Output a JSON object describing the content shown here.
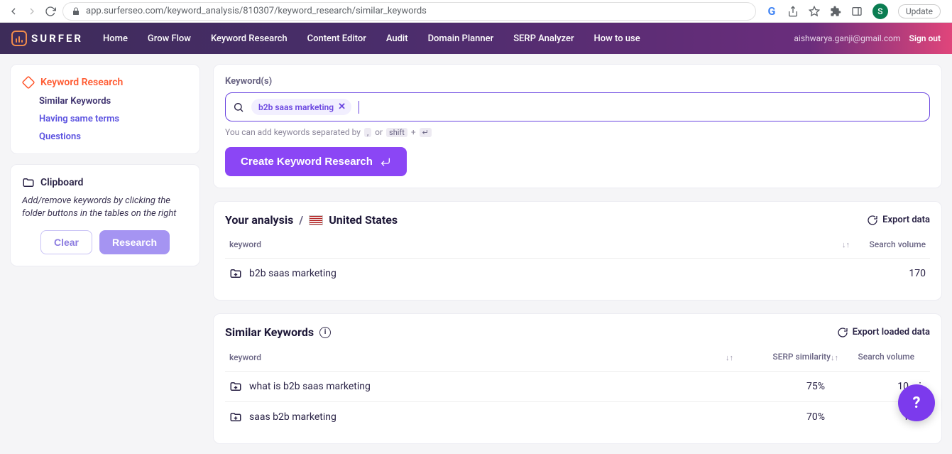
{
  "browser": {
    "url": "app.surferseo.com/keyword_analysis/810307/keyword_research/similar_keywords",
    "avatar_letter": "S",
    "update_label": "Update"
  },
  "nav": {
    "brand": "SURFER",
    "links": [
      "Home",
      "Grow Flow",
      "Keyword Research",
      "Content Editor",
      "Audit",
      "Domain Planner",
      "SERP Analyzer",
      "How to use"
    ],
    "user_email": "aishwarya.ganji@gmail.com",
    "signout": "Sign out"
  },
  "sidebar": {
    "heading": "Keyword Research",
    "items": [
      {
        "label": "Similar Keywords",
        "active": true
      },
      {
        "label": "Having same terms",
        "active": false
      },
      {
        "label": "Questions",
        "active": false
      }
    ],
    "clipboard": {
      "title": "Clipboard",
      "desc": "Add/remove keywords by clicking the folder buttons in the tables on the right",
      "clear": "Clear",
      "research": "Research"
    }
  },
  "keywords": {
    "label": "Keyword(s)",
    "chips": [
      "b2b saas marketing"
    ],
    "hint_prefix": "You can add keywords separated by",
    "hint_or": "or",
    "hint_kbd_comma": ",",
    "hint_kbd_shift": "shift",
    "hint_kbd_plus": "+",
    "hint_kbd_enter": "↵",
    "create_btn": "Create Keyword Research"
  },
  "analysis": {
    "title_prefix": "Your analysis",
    "sep": "/",
    "country": "United States",
    "export": "Export data",
    "col_keyword": "keyword",
    "col_search_volume": "Search volume",
    "rows": [
      {
        "keyword": "b2b saas marketing",
        "volume": "170"
      }
    ]
  },
  "similar": {
    "title": "Similar Keywords",
    "export": "Export loaded data",
    "col_keyword": "keyword",
    "col_similarity": "SERP similarity",
    "col_search_volume": "Search volume",
    "rows": [
      {
        "keyword": "what is b2b saas marketing",
        "similarity": "75%",
        "volume": "10"
      },
      {
        "keyword": "saas b2b marketing",
        "similarity": "70%",
        "volume": "1"
      }
    ]
  },
  "help_fab": "?"
}
